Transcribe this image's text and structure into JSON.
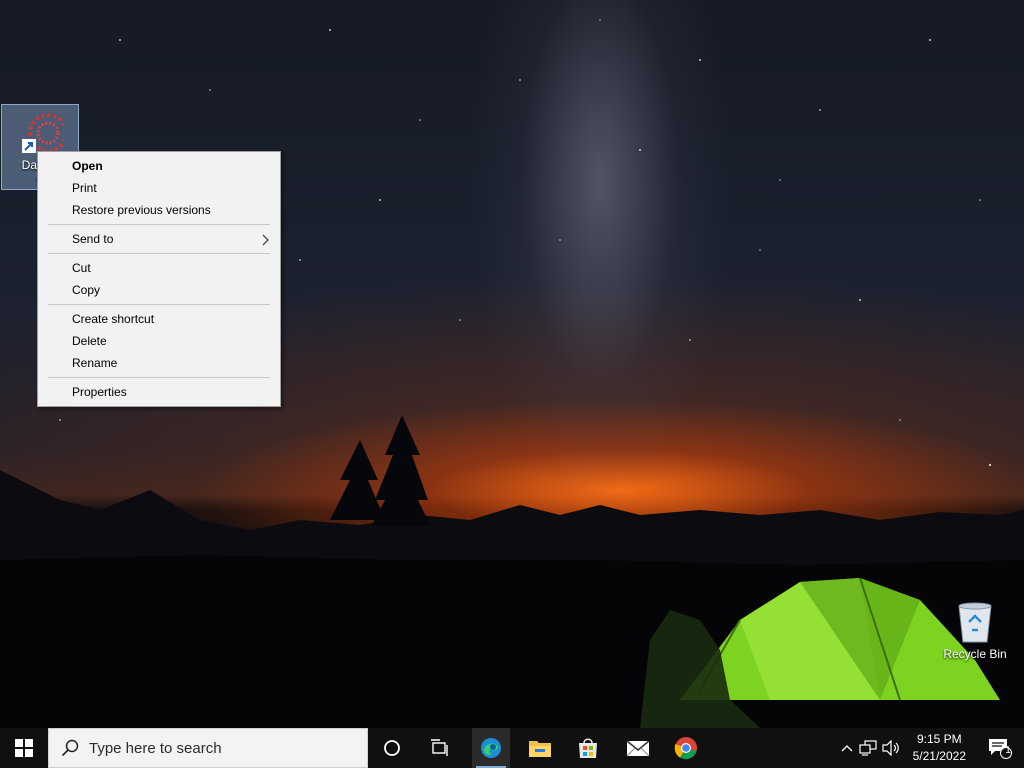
{
  "desktop": {
    "icons": [
      {
        "label": "DataW…\no",
        "label_line1": "DataW",
        "label_line2": "o"
      },
      {
        "label": "Recycle Bin"
      }
    ]
  },
  "context_menu": {
    "items": {
      "open": "Open",
      "print": "Print",
      "restore": "Restore previous versions",
      "send_to": "Send to",
      "cut": "Cut",
      "copy": "Copy",
      "create_shortcut": "Create shortcut",
      "delete": "Delete",
      "rename": "Rename",
      "properties": "Properties"
    },
    "send_to_arrow": "›"
  },
  "taskbar": {
    "search_placeholder": "Type here to search",
    "clock_time": "9:15 PM",
    "clock_date": "5/21/2022",
    "notification_count": "1"
  },
  "colors": {
    "accent": "#7fb0e0",
    "taskbar": "#101010",
    "menu_bg": "#f2f2f2"
  }
}
